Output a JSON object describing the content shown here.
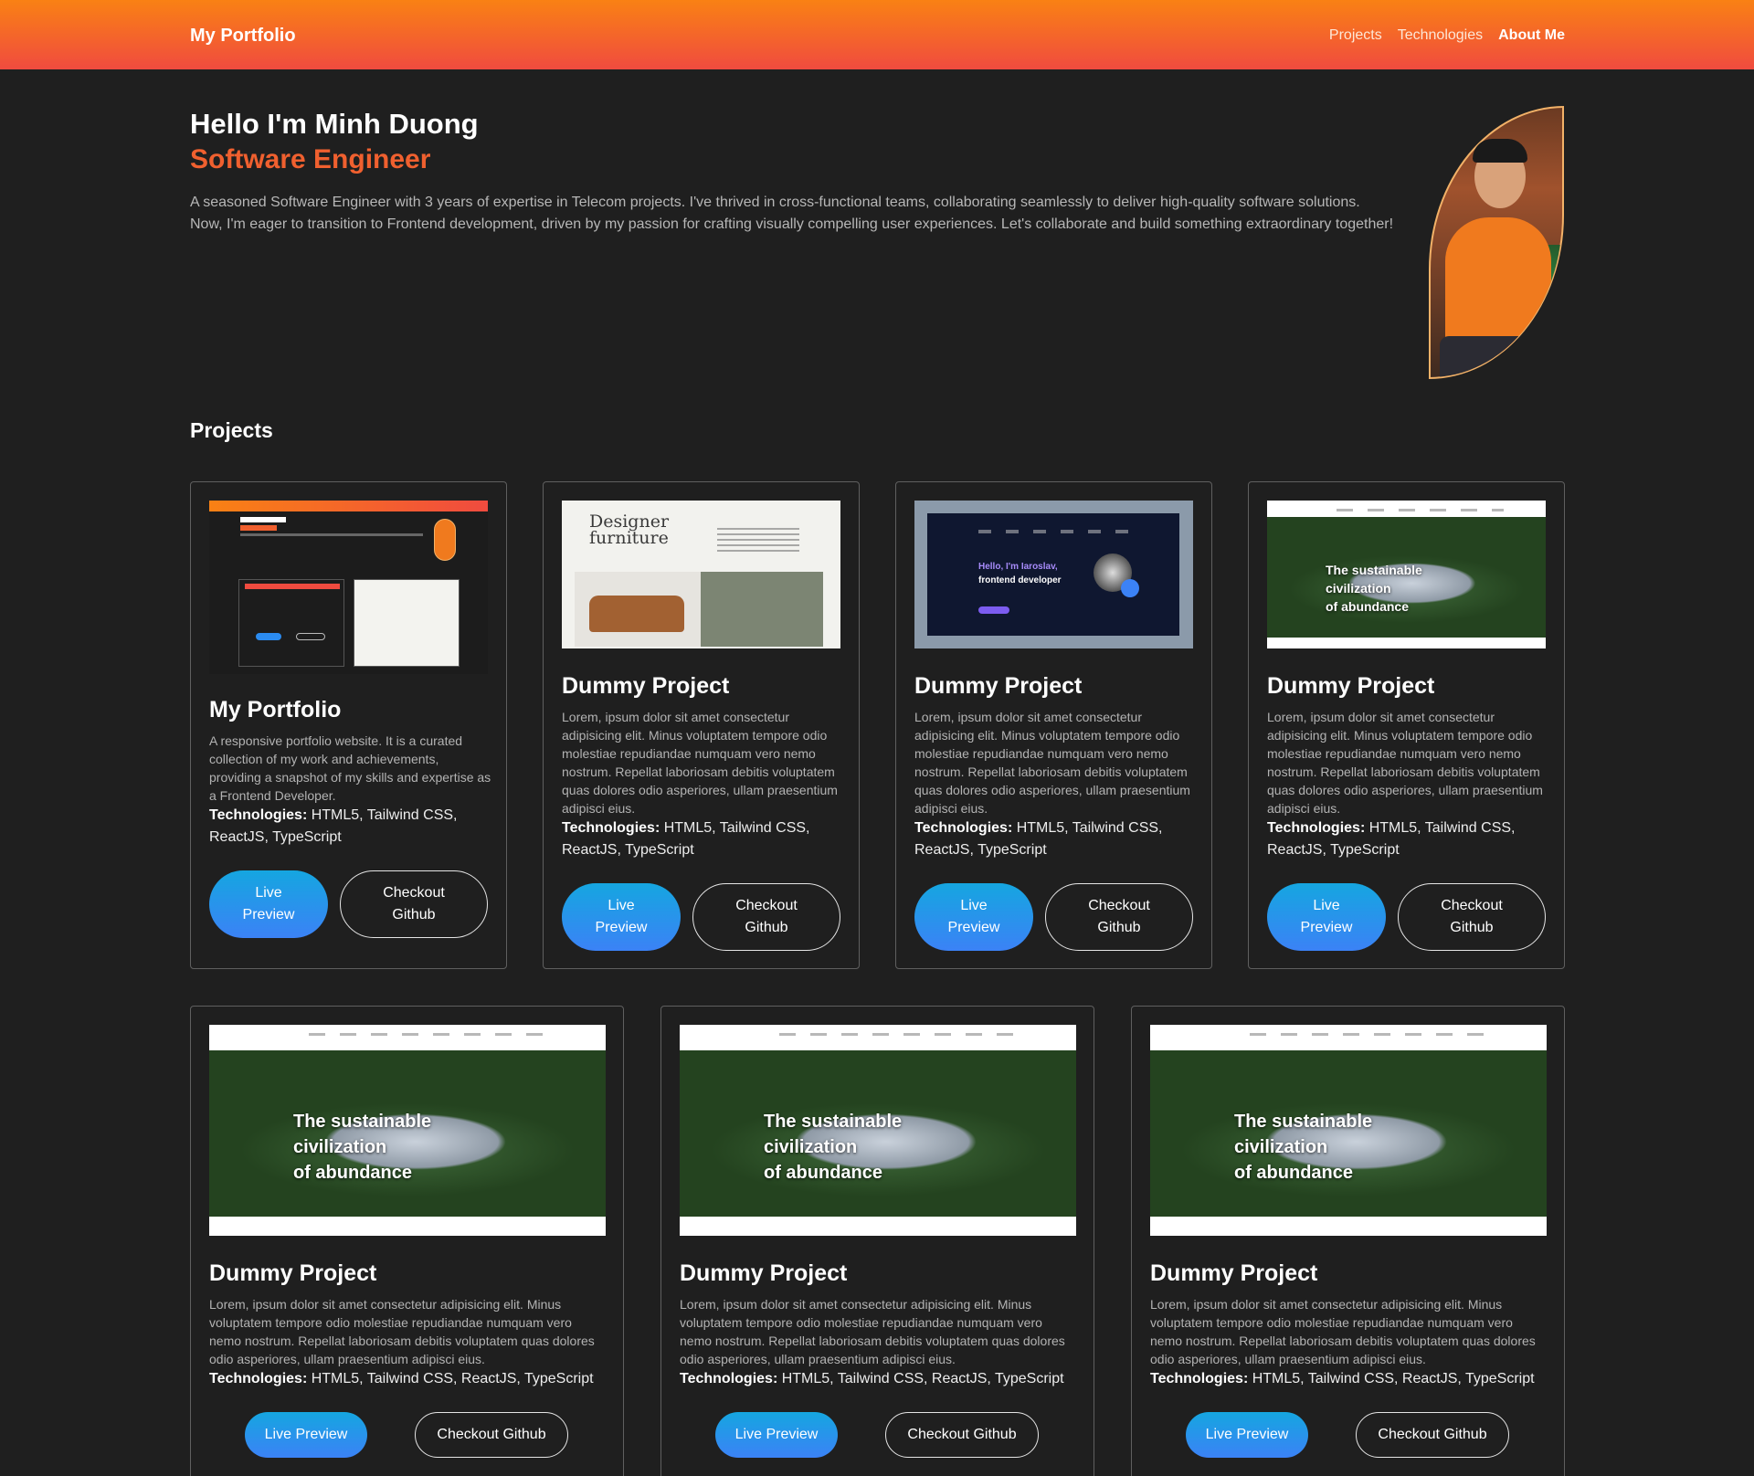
{
  "header": {
    "brand": "My Portfolio",
    "nav": [
      "Projects",
      "Technologies",
      "About Me"
    ],
    "active_nav": "About Me"
  },
  "hero": {
    "greeting": "Hello I'm Minh Duong",
    "role": "Software Engineer",
    "bio": "A seasoned Software Engineer with 3 years of expertise in Telecom projects. I've thrived in cross-functional teams, collaborating seamlessly to deliver high-quality software solutions. Now, I'm eager to transition to Frontend development, driven by my passion for crafting visually compelling user experiences. Let's collaborate and build something extraordinary together!"
  },
  "projects_title": "Projects",
  "tech_label": "Technologies:",
  "projects": [
    {
      "title": "My Portfolio",
      "description": "A responsive portfolio website. It is a curated collection of my work and achievements, providing a snapshot of my skills and expertise as a Frontend Developer.",
      "technologies": "HTML5, Tailwind CSS, ReactJS, TypeScript",
      "live_label": "Live Preview",
      "github_label": "Checkout Github"
    },
    {
      "title": "Dummy Project",
      "description": "Lorem, ipsum dolor sit amet consectetur adipisicing elit. Minus voluptatem tempore odio molestiae repudiandae numquam vero nemo nostrum. Repellat laboriosam debitis voluptatem quas dolores odio asperiores, ullam praesentium adipisci eius.",
      "technologies": "HTML5, Tailwind CSS, ReactJS, TypeScript",
      "live_label": "Live Preview",
      "github_label": "Checkout Github",
      "thumb": {
        "logo": "Designer furniture"
      }
    },
    {
      "title": "Dummy Project",
      "description": "Lorem, ipsum dolor sit amet consectetur adipisicing elit. Minus voluptatem tempore odio molestiae repudiandae numquam vero nemo nostrum. Repellat laboriosam debitis voluptatem quas dolores odio asperiores, ullam praesentium adipisci eius.",
      "technologies": "HTML5, Tailwind CSS, ReactJS, TypeScript",
      "live_label": "Live Preview",
      "github_label": "Checkout Github",
      "thumb": {
        "hello": "Hello, I'm Iaroslav,",
        "role": "frontend developer"
      }
    },
    {
      "title": "Dummy Project",
      "description": "Lorem, ipsum dolor sit amet consectetur adipisicing elit. Minus voluptatem tempore odio molestiae repudiandae numquam vero nemo nostrum. Repellat laboriosam debitis voluptatem quas dolores odio asperiores, ullam praesentium adipisci eius.",
      "technologies": "HTML5, Tailwind CSS, ReactJS, TypeScript",
      "live_label": "Live Preview",
      "github_label": "Checkout Github",
      "thumb": {
        "line1": "The sustainable",
        "line2": "civilization",
        "line3": "of abundance"
      }
    },
    {
      "title": "Dummy Project",
      "description": "Lorem, ipsum dolor sit amet consectetur adipisicing elit. Minus voluptatem tempore odio molestiae repudiandae numquam vero nemo nostrum. Repellat laboriosam debitis voluptatem quas dolores odio asperiores, ullam praesentium adipisci eius.",
      "technologies": "HTML5, Tailwind CSS, ReactJS, TypeScript",
      "live_label": "Live Preview",
      "github_label": "Checkout Github",
      "thumb": {
        "line1": "The sustainable",
        "line2": "civilization",
        "line3": "of abundance"
      }
    },
    {
      "title": "Dummy Project",
      "description": "Lorem, ipsum dolor sit amet consectetur adipisicing elit. Minus voluptatem tempore odio molestiae repudiandae numquam vero nemo nostrum. Repellat laboriosam debitis voluptatem quas dolores odio asperiores, ullam praesentium adipisci eius.",
      "technologies": "HTML5, Tailwind CSS, ReactJS, TypeScript",
      "live_label": "Live Preview",
      "github_label": "Checkout Github",
      "thumb": {
        "line1": "The sustainable",
        "line2": "civilization",
        "line3": "of abundance"
      }
    },
    {
      "title": "Dummy Project",
      "description": "Lorem, ipsum dolor sit amet consectetur adipisicing elit. Minus voluptatem tempore odio molestiae repudiandae numquam vero nemo nostrum. Repellat laboriosam debitis voluptatem quas dolores odio asperiores, ullam praesentium adipisci eius.",
      "technologies": "HTML5, Tailwind CSS, ReactJS, TypeScript",
      "live_label": "Live Preview",
      "github_label": "Checkout Github",
      "thumb": {
        "line1": "The sustainable",
        "line2": "civilization",
        "line3": "of abundance"
      }
    }
  ],
  "colors": {
    "header_top": "#f98114",
    "header_bottom": "#f04b3f",
    "accent": "#f0602f",
    "background": "#1f1f1f",
    "live_button_top": "#15a6e0",
    "live_button_bottom": "#3b82f6"
  }
}
